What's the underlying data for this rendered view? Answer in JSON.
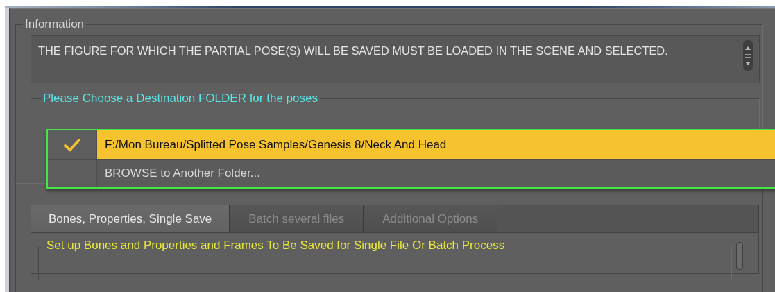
{
  "information": {
    "title": "Information",
    "message": "THE FIGURE FOR WHICH THE PARTIAL POSE(S) WILL BE SAVED MUST BE LOADED IN THE SCENE AND SELECTED."
  },
  "destination": {
    "title": "Please Choose a Destination FOLDER for the poses",
    "options": [
      {
        "label": "F:/Mon Bureau/Splitted Pose Samples/Genesis 8/Neck And Head",
        "selected": true,
        "checked": true
      },
      {
        "label": "BROWSE to Another Folder...",
        "selected": false,
        "checked": false
      }
    ]
  },
  "tabs": [
    {
      "label": "Bones, Properties, Single Save",
      "selected": true
    },
    {
      "label": "Batch several files",
      "selected": false
    },
    {
      "label": "Additional Options",
      "selected": false
    }
  ],
  "tab_content": {
    "group_title": "Set up Bones and Properties and Frames To Be Saved for Single File Or Batch Process"
  }
}
